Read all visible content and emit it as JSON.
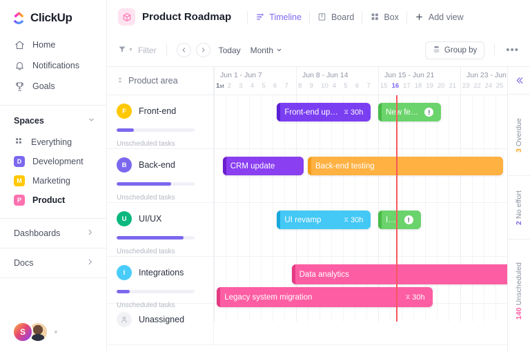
{
  "brand": {
    "name": "ClickUp",
    "accent": "#7b68ee",
    "today_line": "#f8575c"
  },
  "sidebar": {
    "nav": [
      {
        "label": "Home",
        "icon": "home-icon"
      },
      {
        "label": "Notifications",
        "icon": "bell-icon"
      },
      {
        "label": "Goals",
        "icon": "trophy-icon"
      }
    ],
    "spaces_header": "Spaces",
    "spaces": [
      {
        "label": "Everything",
        "icon": "grid-dots-icon",
        "initial": "",
        "color": "",
        "active": false
      },
      {
        "label": "Development",
        "icon": "space-square",
        "initial": "D",
        "color": "#7b68ee",
        "active": false
      },
      {
        "label": "Marketing",
        "icon": "space-square",
        "initial": "M",
        "color": "#ffc800",
        "active": false
      },
      {
        "label": "Product",
        "icon": "space-square",
        "initial": "P",
        "color": "#fd71af",
        "active": true
      }
    ],
    "footer": [
      {
        "label": "Dashboards",
        "icon": "chevron-right-icon"
      },
      {
        "label": "Docs",
        "icon": "chevron-right-icon"
      }
    ],
    "user": {
      "initial": "S",
      "has_second_avatar": true
    }
  },
  "header": {
    "title": "Product Roadmap",
    "badge_icon": "cube-icon",
    "tabs": [
      {
        "label": "Timeline",
        "icon": "timeline-icon",
        "active": true
      },
      {
        "label": "Board",
        "icon": "board-icon",
        "active": false
      },
      {
        "label": "Box",
        "icon": "box-icon",
        "active": false
      }
    ],
    "add_view": "Add view"
  },
  "toolbar": {
    "filter_label": "Filter",
    "filter_icon": "funnel-icon",
    "prev_icon": "chevron-left-icon",
    "next_icon": "chevron-right-icon",
    "today_label": "Today",
    "zoom_label": "Month",
    "zoom_caret": "chevron-down-icon",
    "group_by_label": "Group by",
    "group_by_icon": "layers-icon",
    "more_icon": "ellipsis-icon"
  },
  "timeline": {
    "group_column_label": "Product area",
    "group_column_icon": "sort-icon",
    "collapse_icon": "double-chevron-left-icon",
    "weeks": [
      {
        "label": "Jun 1 - Jun 7",
        "days": [
          "1st",
          "2",
          "3",
          "4",
          "5",
          "6",
          "7"
        ]
      },
      {
        "label": "Jun 8 - Jun 14",
        "days": [
          "8",
          "9",
          "10",
          "4",
          "5",
          "6",
          "7"
        ]
      },
      {
        "label": "Jun 15 - Jun 21",
        "days": [
          "15",
          "16",
          "17",
          "18",
          "19",
          "20",
          "21"
        ]
      },
      {
        "label": "Jun 23 - Jun",
        "days": [
          "23",
          "22",
          "24",
          "25"
        ]
      }
    ],
    "today_day": "16",
    "rows": [
      {
        "name": "Front-end",
        "initial": "F",
        "avatar_color": "#ffc800",
        "progress_pct": 22,
        "unscheduled_label": "Unscheduled tasks",
        "bars": [
          {
            "label": "Front-end upgrade",
            "effort": "30h",
            "color": "#7b3ff2",
            "edge": "#5a1fd6",
            "start_pct": 21.5,
            "width_pct": 32.0,
            "warn": false
          },
          {
            "label": "New feature..",
            "effort": "",
            "color": "#6bd36b",
            "edge": "#48bb48",
            "start_pct": 56.0,
            "width_pct": 21.5,
            "warn": true
          }
        ]
      },
      {
        "name": "Back-end",
        "initial": "B",
        "avatar_color": "#7b68ee",
        "progress_pct": 70,
        "unscheduled_label": "Unscheduled tasks",
        "bars": [
          {
            "label": "CRM update",
            "effort": "",
            "color": "#8a3ff0",
            "edge": "#6a1ed0",
            "start_pct": 3.0,
            "width_pct": 27.5,
            "warn": false
          },
          {
            "label": "Back-end testing",
            "effort": "",
            "color": "#ffb142",
            "edge": "#f49c1a",
            "start_pct": 32.0,
            "width_pct": 66.5,
            "warn": false
          }
        ]
      },
      {
        "name": "UI/UX",
        "initial": "U",
        "avatar_color": "#0ab87f",
        "progress_pct": 86,
        "unscheduled_label": "Unscheduled tasks",
        "bars": [
          {
            "label": "UI revamp",
            "effort": "30h",
            "color": "#44c8f5",
            "edge": "#16a8da",
            "start_pct": 21.5,
            "width_pct": 32.0,
            "warn": false
          },
          {
            "label": "Implem..",
            "effort": "",
            "color": "#6bd36b",
            "edge": "#48bb48",
            "start_pct": 56.0,
            "width_pct": 14.5,
            "warn": true
          }
        ]
      },
      {
        "name": "Integrations",
        "initial": "I",
        "avatar_color": "#49ccf9",
        "progress_pct": 17,
        "unscheduled_label": "Unscheduled tasks",
        "bars": [
          {
            "label": "Data analytics",
            "effort": "",
            "color": "#fd5ea3",
            "edge": "#e63a85",
            "start_pct": 26.5,
            "width_pct": 77.0,
            "warn": false
          },
          {
            "label": "Legacy system migration",
            "effort": "30h",
            "color": "#fd5ea3",
            "edge": "#e63a85",
            "start_pct": 1.0,
            "width_pct": 73.5,
            "warn": false
          }
        ]
      },
      {
        "name": "Unassigned",
        "initial": "",
        "avatar_color": "#f1f2f5",
        "avatar_icon": "person-icon",
        "progress_pct": null,
        "unscheduled_label": "",
        "bars": []
      }
    ]
  },
  "right_rail": {
    "collapse_icon": "double-chevron-left-icon",
    "segments": [
      {
        "count": "3",
        "label": "Overdue",
        "color": "#ffa726"
      },
      {
        "count": "2",
        "label": "No effort",
        "color": "#7b68ee"
      },
      {
        "count": "140",
        "label": "Unscheduled",
        "color": "#fd5ea3"
      }
    ]
  }
}
